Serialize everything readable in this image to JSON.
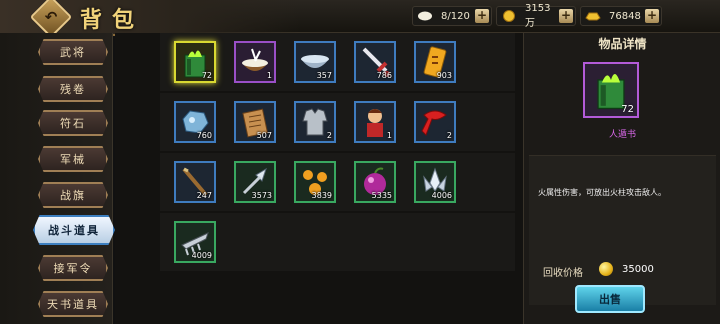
{
  "header": {
    "title": "背包",
    "resources": [
      {
        "icon": "bag-capacity-icon",
        "value": "8/120"
      },
      {
        "icon": "gold-coin-icon",
        "value": "3153万"
      },
      {
        "icon": "gold-ingot-icon",
        "value": "76848"
      }
    ],
    "plus_label": "+"
  },
  "sidebar": {
    "items": [
      {
        "label": "武将"
      },
      {
        "label": "残卷"
      },
      {
        "label": "符石"
      },
      {
        "label": "军械"
      },
      {
        "label": "战旗"
      },
      {
        "label": "战斗道具",
        "active": true
      },
      {
        "label": "接军令"
      },
      {
        "label": "天书道具"
      }
    ]
  },
  "inventory": {
    "items": [
      {
        "icon": "green-fire-book-icon",
        "qty": "72",
        "rarity": "yellow"
      },
      {
        "icon": "rice-bowl-icon",
        "qty": "1",
        "rarity": "purple"
      },
      {
        "icon": "silver-bowl-icon",
        "qty": "357",
        "rarity": "blue"
      },
      {
        "icon": "sword-icon",
        "qty": "786",
        "rarity": "blue"
      },
      {
        "icon": "golden-token-icon",
        "qty": "903",
        "rarity": "blue"
      },
      {
        "icon": "blue-ore-icon",
        "qty": "760",
        "rarity": "blue"
      },
      {
        "icon": "scroll-icon",
        "qty": "507",
        "rarity": "blue"
      },
      {
        "icon": "armor-icon",
        "qty": "2",
        "rarity": "blue"
      },
      {
        "icon": "general-figure-icon",
        "qty": "1",
        "rarity": "blue"
      },
      {
        "icon": "red-scarf-icon",
        "qty": "2",
        "rarity": "blue"
      },
      {
        "icon": "wooden-staff-icon",
        "qty": "247",
        "rarity": "blue"
      },
      {
        "icon": "arrowhead-icon",
        "qty": "3573",
        "rarity": "green"
      },
      {
        "icon": "orange-orbs-icon",
        "qty": "3839",
        "rarity": "green"
      },
      {
        "icon": "purple-fruit-icon",
        "qty": "5335",
        "rarity": "green"
      },
      {
        "icon": "silver-lotus-icon",
        "qty": "4006",
        "rarity": "green"
      },
      {
        "icon": "claw-blade-icon",
        "qty": "4009",
        "rarity": "green"
      }
    ]
  },
  "detail": {
    "title": "物品详情",
    "icon": "green-fire-book-icon",
    "qty": "72",
    "name": "人遁书",
    "description": "火属性伤害，可放出火柱攻击敌人。",
    "recycle_label": "回收价格",
    "recycle_value": "35000",
    "sell_label": "出售"
  },
  "colors": {
    "accent": "#f1d37a",
    "rarity_blue": "#3f7cbf",
    "rarity_green": "#39a860",
    "rarity_purple": "#9a4fc7",
    "selected": "#d9d832",
    "item_name": "#d868e8"
  }
}
